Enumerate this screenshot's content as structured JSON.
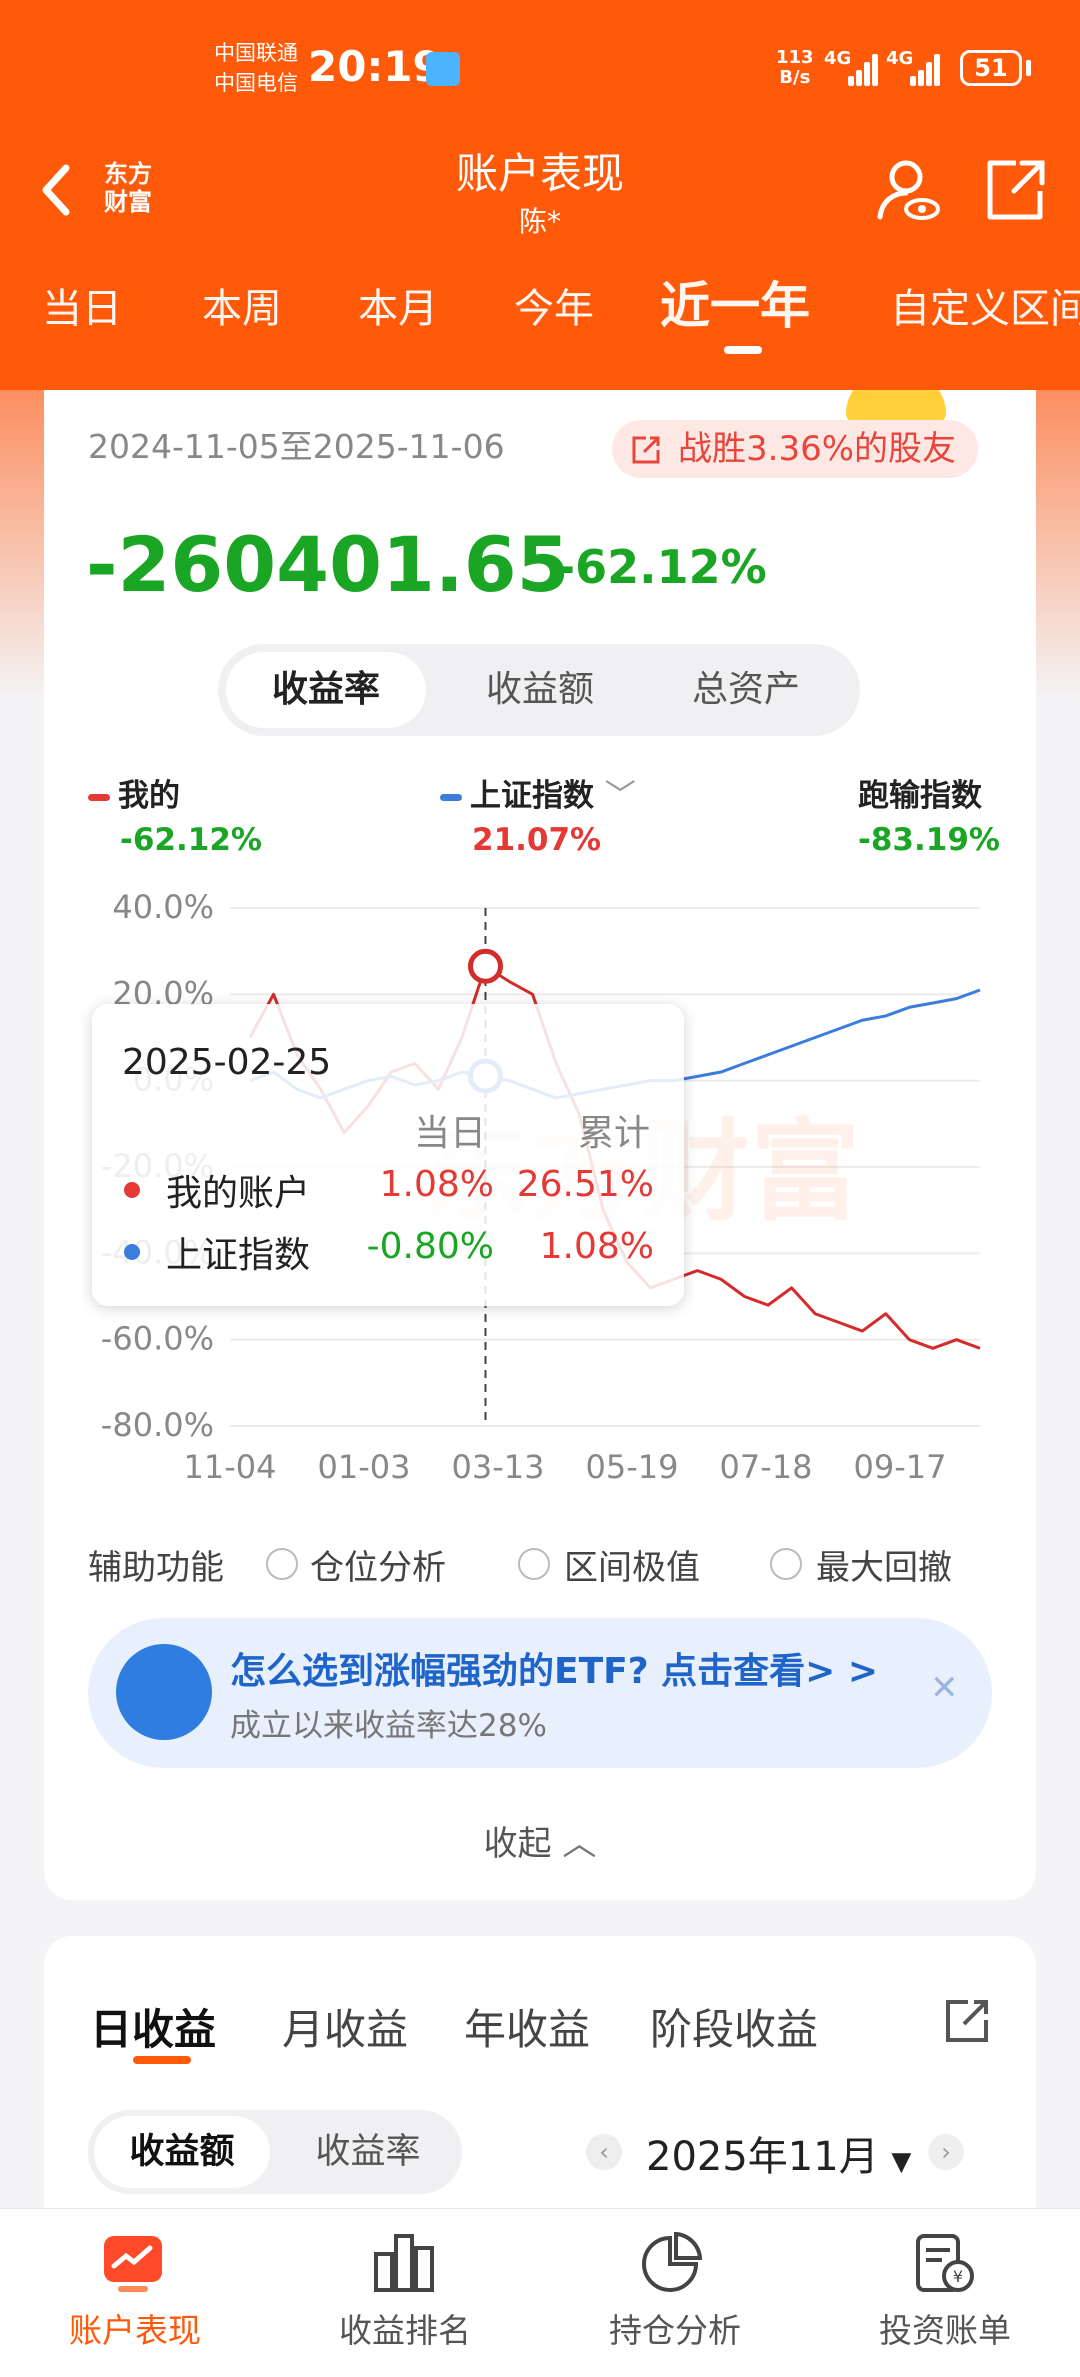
{
  "status": {
    "carrier1": "中国联通",
    "carrier2": "中国电信",
    "time": "20:19",
    "speed_num": "113",
    "speed_unit": "B/s",
    "sig1": "4G",
    "sig2": "4G",
    "battery": "51"
  },
  "header": {
    "title": "账户表现",
    "subtitle": "陈*",
    "logo_line1": "东方",
    "logo_line2": "财富"
  },
  "tabs": [
    "当日",
    "本周",
    "本月",
    "今年",
    "近一年",
    "自定义区间"
  ],
  "summary": {
    "date_range": "2024-11-05至2025-11-06",
    "beat_text": "战胜3.36%的股友",
    "value": "-260401.65",
    "pct": "-62.12%"
  },
  "segments": [
    "收益率",
    "收益额",
    "总资产"
  ],
  "legend": [
    {
      "name": "我的",
      "value": "-62.12%",
      "color": "#e53935",
      "value_color": "#1aa624"
    },
    {
      "name": "上证指数",
      "value": "21.07%",
      "color": "#3b7ddd",
      "value_color": "#e53935"
    },
    {
      "name": "跑输指数",
      "value": "-83.19%",
      "value_color": "#1aa624"
    }
  ],
  "chart_data": {
    "type": "line",
    "ylabels": [
      "40.0%",
      "20.0%",
      "0.0%",
      "-20.0%",
      "-40.0%",
      "-60.0%",
      "-80.0%"
    ],
    "ylim": [
      -80,
      40
    ],
    "xlabels": [
      "11-04",
      "01-03",
      "03-13",
      "05-19",
      "07-18",
      "09-17"
    ],
    "series": [
      {
        "name": "我的",
        "color": "#d42b2b",
        "values": [
          10,
          20,
          6,
          -2,
          -12,
          -6,
          2,
          4,
          -2,
          10,
          26.5,
          23,
          20,
          4,
          -8,
          -30,
          -42,
          -48,
          -46,
          -44,
          -46,
          -50,
          -52,
          -48,
          -54,
          -56,
          -58,
          -54,
          -60,
          -62,
          -60,
          -62
        ]
      },
      {
        "name": "上证指数",
        "color": "#3b7ddd",
        "values": [
          0,
          2,
          -2,
          -4,
          -2,
          0,
          1,
          -1,
          0,
          2,
          1.08,
          0,
          -2,
          -4,
          -3,
          -2,
          -1,
          0,
          0,
          1,
          2,
          4,
          6,
          8,
          10,
          12,
          14,
          15,
          17,
          18,
          19,
          21
        ]
      }
    ]
  },
  "tooltip": {
    "date": "2025-02-25",
    "col1": "当日",
    "col2": "累计",
    "rows": [
      {
        "label": "我的账户",
        "day": "1.08%",
        "cum": "26.51%",
        "color": "#e53935",
        "day_color": "#e53935",
        "cum_color": "#e53935"
      },
      {
        "label": "上证指数",
        "day": "-0.80%",
        "cum": "1.08%",
        "color": "#3b7ddd",
        "day_color": "#1aa624",
        "cum_color": "#e53935"
      }
    ]
  },
  "aux": {
    "label": "辅助功能",
    "options": [
      "仓位分析",
      "区间极值",
      "最大回撤"
    ]
  },
  "promo": {
    "title": "怎么选到涨幅强劲的ETF? 点击查看> >",
    "sub": "成立以来收益率达28%"
  },
  "collapse_label": "收起",
  "profit_tabs": [
    "日收益",
    "月收益",
    "年收益",
    "阶段收益"
  ],
  "profit_seg": [
    "收益额",
    "收益率"
  ],
  "month": "2025年11月",
  "bottom_nav": [
    "账户表现",
    "收益排名",
    "持仓分析",
    "投资账单"
  ]
}
